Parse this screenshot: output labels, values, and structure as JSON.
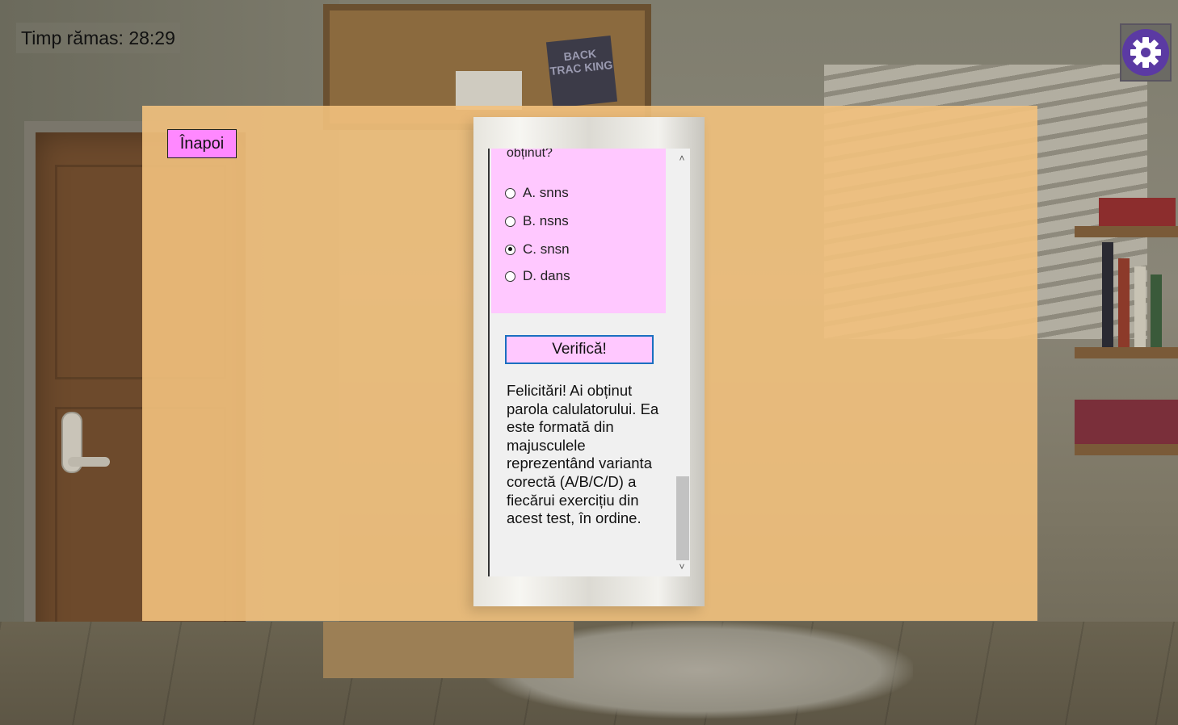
{
  "hud": {
    "timer_text": "Timp rămas: 28:29",
    "settings_icon": "gear-icon",
    "settings_color": "#5b3aa3"
  },
  "scene": {
    "board_sign": "BACK TRAC KING"
  },
  "dialog": {
    "back_label": "Înapoi",
    "question_tail": "obținut?",
    "options": [
      {
        "label": "A. snns",
        "selected": false
      },
      {
        "label": "B. nsns",
        "selected": false
      },
      {
        "label": "C. snsn",
        "selected": true
      },
      {
        "label": "D. dans",
        "selected": false
      }
    ],
    "verify_label": "Verifică!",
    "result_text": "Felicitări! Ai obținut parola calulatorului. Ea este formată din majusculele reprezentând varianta corectă (A/B/C/D) a fiecărui exercițiu din acest test, în ordine."
  },
  "colors": {
    "overlay_bg": "#f2c17d",
    "accent_pink": "#ffc8ff",
    "back_button": "#ff88ff",
    "verify_border": "#1a6fc0"
  }
}
